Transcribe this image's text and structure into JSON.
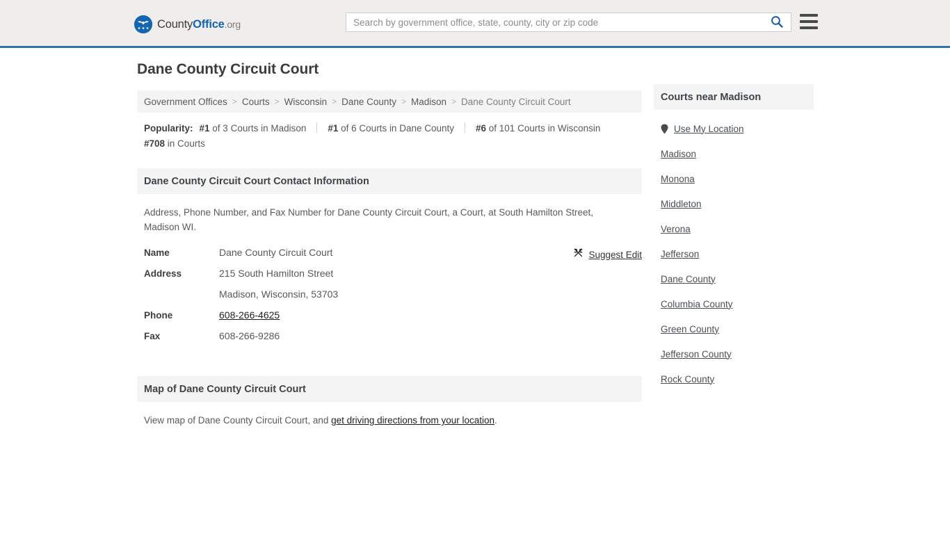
{
  "header": {
    "logo": {
      "part1": "County",
      "part2": "Office",
      "part3": ".org",
      "icon": "eagle-seal-icon"
    },
    "search": {
      "placeholder": "Search by government office, state, county, city or zip code",
      "value": "",
      "button_icon": "search-icon"
    },
    "menu_icon": "hamburger-menu-icon",
    "accent_color": "#2f74ad"
  },
  "page": {
    "title": "Dane County Circuit Court"
  },
  "breadcrumb": {
    "separator": ">",
    "items": [
      {
        "label": "Government Offices"
      },
      {
        "label": "Courts"
      },
      {
        "label": "Wisconsin"
      },
      {
        "label": "Dane County"
      },
      {
        "label": "Madison"
      },
      {
        "label": "Dane County Circuit Court"
      }
    ]
  },
  "popularity": {
    "label": "Popularity:",
    "items": [
      {
        "rank": "#1",
        "rest": " of 3 Courts in Madison"
      },
      {
        "rank": "#1",
        "rest": " of 6 Courts in Dane County"
      },
      {
        "rank": "#6",
        "rest": " of 101 Courts in Wisconsin"
      },
      {
        "rank": "#708",
        "rest": " in Courts"
      }
    ]
  },
  "contact_section": {
    "heading": "Dane County Circuit Court Contact Information",
    "description": "Address, Phone Number, and Fax Number for Dane County Circuit Court, a Court, at South Hamilton Street, Madison WI.",
    "suggest_edit": {
      "label": "Suggest Edit",
      "icon": "edit-pencil-icon"
    },
    "rows": [
      {
        "label": "Name",
        "value": "Dane County Circuit Court",
        "link": false
      },
      {
        "label": "Address",
        "value": "215 South Hamilton Street",
        "link": false
      },
      {
        "label": "",
        "value": "Madison, Wisconsin, 53703",
        "link": false
      },
      {
        "label": "Phone",
        "value": "608-266-4625",
        "link": true
      },
      {
        "label": "Fax",
        "value": "608-266-9286",
        "link": false
      }
    ]
  },
  "map_section": {
    "heading": "Map of Dane County Circuit Court",
    "text_before": "View map of Dane County Circuit Court, and ",
    "link": "get driving directions from your location",
    "text_after": "."
  },
  "sidebar": {
    "heading": "Courts near Madison",
    "use_my_location": {
      "label": "Use My Location",
      "icon": "map-pin-icon"
    },
    "items": [
      {
        "label": "Madison"
      },
      {
        "label": "Monona"
      },
      {
        "label": "Middleton"
      },
      {
        "label": "Verona"
      },
      {
        "label": "Jefferson"
      },
      {
        "label": "Dane County"
      },
      {
        "label": "Columbia County"
      },
      {
        "label": "Green County"
      },
      {
        "label": "Jefferson County"
      },
      {
        "label": "Rock County"
      }
    ]
  }
}
